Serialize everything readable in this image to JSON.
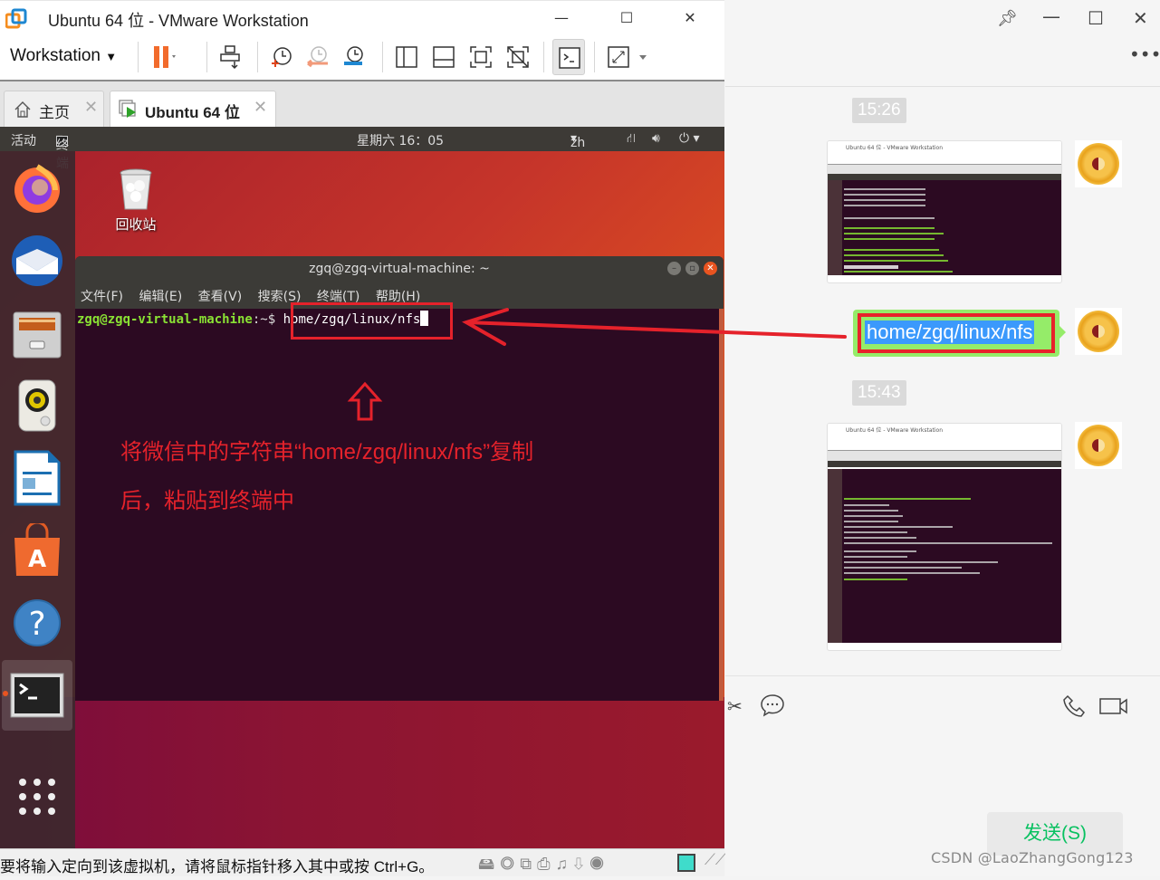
{
  "vmware": {
    "window_title": "Ubuntu 64 位 - VMware Workstation",
    "menu_label": "Workstation",
    "tabs": [
      {
        "label": "主页",
        "icon": "home-icon",
        "active": false
      },
      {
        "label": "Ubuntu 64 位",
        "icon": "vm-running-icon",
        "active": true
      }
    ],
    "status_message": "要将输入定向到该虚拟机，请将鼠标指针移入其中或按 Ctrl+G。",
    "accent_color": "#f26b2c"
  },
  "ubuntu": {
    "topbar": {
      "activities": "活动",
      "app_menu": "终端",
      "clock": "星期六 16：05",
      "input_method": "zh"
    },
    "dock": [
      {
        "name": "firefox"
      },
      {
        "name": "thunderbird"
      },
      {
        "name": "files"
      },
      {
        "name": "rhythmbox"
      },
      {
        "name": "libreoffice-writer"
      },
      {
        "name": "ubuntu-software"
      },
      {
        "name": "help"
      },
      {
        "name": "terminal",
        "active": true
      },
      {
        "name": "show-applications"
      }
    ],
    "desktop_icons": [
      {
        "label": "回收站"
      }
    ],
    "terminal": {
      "title": "zgq@zgq-virtual-machine: ~",
      "menu": [
        "文件(F)",
        "编辑(E)",
        "查看(V)",
        "搜索(S)",
        "终端(T)",
        "帮助(H)"
      ],
      "prompt": "zgq@zgq-virtual-machine",
      "prompt_tail": ":~$ ",
      "input": "home/zgq/linux/nfs"
    }
  },
  "annotation": {
    "line1": "将微信中的字符串“home/zgq/linux/nfs”复制",
    "line2": "后，粘贴到终端中",
    "color": "#e5222b"
  },
  "wechat": {
    "messages": [
      {
        "type": "time",
        "text": "15:26"
      },
      {
        "type": "image",
        "sender": "self",
        "desc": "terminal screenshot: mkdir nfs, cd nfs, pwd"
      },
      {
        "type": "text",
        "sender": "self",
        "text": "home/zgq/linux/nfs",
        "selected": true
      },
      {
        "type": "time",
        "text": "15:43"
      },
      {
        "type": "image",
        "sender": "self",
        "desc": "terminal screenshot: sudo apt-get autoremove open-vm-tools"
      }
    ],
    "send_label": "发送(S)",
    "bubble_color": "#95ec69",
    "send_color": "#07c160"
  },
  "watermark": "CSDN @LaoZhangGong123"
}
